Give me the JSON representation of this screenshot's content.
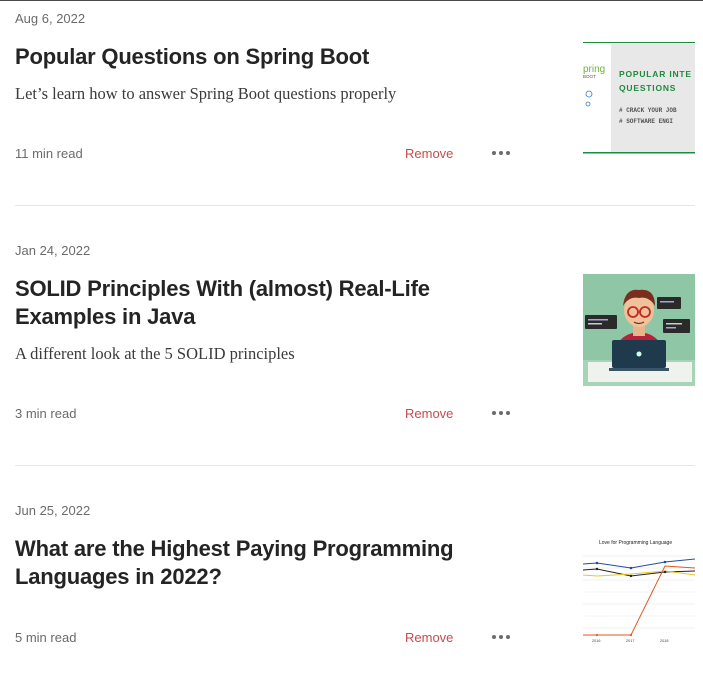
{
  "articles": [
    {
      "date": "Aug 6, 2022",
      "title": "Popular Questions on Spring Boot",
      "subtitle": "Let’s learn how to answer Spring Boot questions properly",
      "read_time": "11 min read",
      "remove_label": "Remove",
      "thumb": {
        "brand": "pring",
        "brand_sub": "BOOT",
        "head1": "POPULAR INTE",
        "head2": "QUESTIONS",
        "line1": "# CRACK YOUR JOB",
        "line2": "# SOFTWARE ENGI",
        "accent": "#1e8a3c"
      }
    },
    {
      "date": "Jan 24, 2022",
      "title": "SOLID Principles With (almost) Real-Life Examples in Java",
      "subtitle": "A different look at the 5 SOLID principles",
      "read_time": "3 min read",
      "remove_label": "Remove",
      "thumb": {
        "bg": "#8fc7a6"
      }
    },
    {
      "date": "Jun 25, 2022",
      "title": "What are the Highest Paying Programming Languages in 2022?",
      "subtitle": "",
      "read_time": "5 min read",
      "remove_label": "Remove",
      "thumb": {
        "chart_title": "Love for Programming Language",
        "x_labels": [
          "2016",
          "2017",
          "2018"
        ]
      }
    }
  ],
  "colors": {
    "remove": "#c94a4a",
    "meta": "#6b6b6b",
    "divider": "#e6e6e6"
  }
}
